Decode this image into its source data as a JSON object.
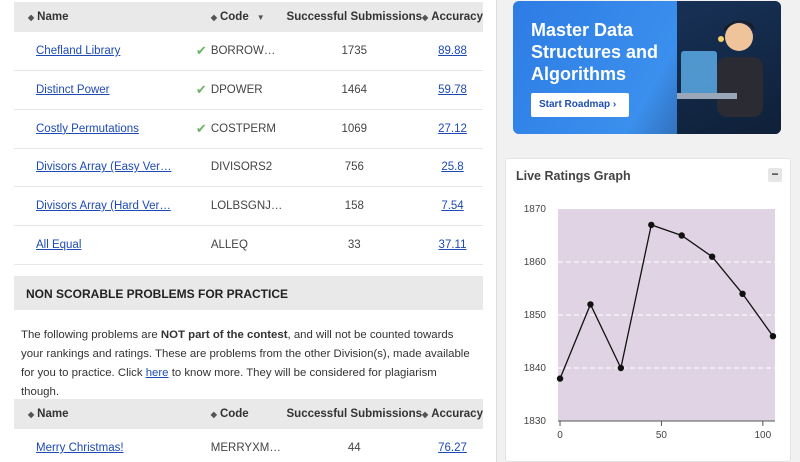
{
  "table1": {
    "headers": {
      "name": "Name",
      "code": "Code",
      "submissions": "Successful Submissions",
      "accuracy": "Accuracy"
    },
    "rows": [
      {
        "name": "Chefland Library",
        "solved": true,
        "code": "BORROW…",
        "submissions": "1735",
        "accuracy": "89.88"
      },
      {
        "name": "Distinct Power",
        "solved": true,
        "code": "DPOWER",
        "submissions": "1464",
        "accuracy": "59.78"
      },
      {
        "name": "Costly Permutations",
        "solved": true,
        "code": "COSTPERM",
        "submissions": "1069",
        "accuracy": "27.12"
      },
      {
        "name": "Divisors Array (Easy Ver…",
        "solved": false,
        "code": "DIVISORS2",
        "submissions": "756",
        "accuracy": "25.8"
      },
      {
        "name": "Divisors Array (Hard Ver…",
        "solved": false,
        "code": "LOLBSGNJ…",
        "submissions": "158",
        "accuracy": "7.54"
      },
      {
        "name": "All Equal",
        "solved": false,
        "code": "ALLEQ",
        "submissions": "33",
        "accuracy": "37.11"
      }
    ]
  },
  "non_scorable": {
    "header": "NON SCORABLE PROBLEMS FOR PRACTICE",
    "text_1": "The following problems are ",
    "text_bold": "NOT part of the contest",
    "text_2": ", and will not be counted towards your rankings and ratings. These are problems from the other Division(s), made available for you to practice. Click ",
    "link": "here",
    "text_3": " to know more. They will be considered for plagiarism though."
  },
  "table2": {
    "headers": {
      "name": "Name",
      "code": "Code",
      "submissions": "Successful Submissions",
      "accuracy": "Accuracy"
    },
    "rows": [
      {
        "name": "Merry Christmas!",
        "code": "MERRYXM…",
        "submissions": "44",
        "accuracy": "76.27"
      }
    ]
  },
  "banner": {
    "title": "Master Data Structures and Algorithms",
    "button": "Start Roadmap  ›"
  },
  "graph": {
    "title": "Live Ratings Graph",
    "collapse": "−"
  },
  "chart_data": {
    "type": "line",
    "x": [
      0,
      15,
      30,
      45,
      60,
      75,
      90,
      105
    ],
    "y": [
      1838,
      1852,
      1840,
      1867,
      1865,
      1861,
      1854,
      1846
    ],
    "xlim": [
      -1,
      106
    ],
    "ylim": [
      1830,
      1870
    ],
    "xticks": [
      0,
      50,
      100
    ],
    "yticks": [
      1830,
      1840,
      1850,
      1860,
      1870
    ],
    "grid": true,
    "colors": {
      "plot_bg": "#e0d4e4",
      "line": "#111111",
      "grid": "#ffffff"
    }
  },
  "colors": {
    "link": "#1e4ab3",
    "check": "#6cb466",
    "header_bg": "#e9e9e9"
  }
}
